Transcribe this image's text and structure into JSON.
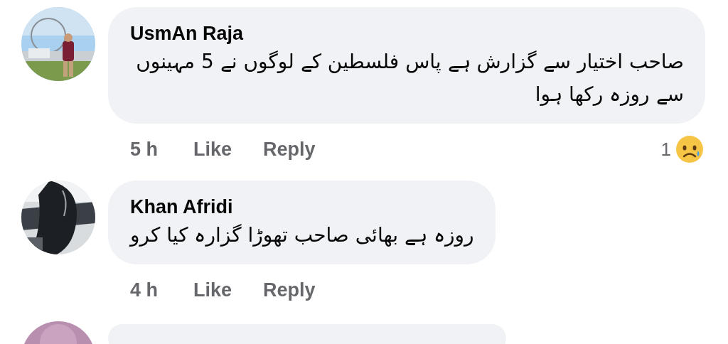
{
  "comments": [
    {
      "kind": "comment",
      "name": "UsmAn Raja",
      "text": "صاحب اختیار سے گزارش ہے پاس فلسطین کے لوگوں نے 5 مہینوں سے روزہ رکھا ہوا",
      "time": "5 h",
      "actions": [
        "Like",
        "Reply"
      ],
      "reaction": {
        "count": "1",
        "kind": "sad"
      }
    },
    {
      "kind": "comment",
      "name": "Khan Afridi",
      "text": "روزہ ہے بھائی صاحب تھوڑا گزارہ کیا کرو",
      "time": "4 h",
      "actions": [
        "Like",
        "Reply"
      ]
    },
    {
      "kind": "partial"
    }
  ]
}
